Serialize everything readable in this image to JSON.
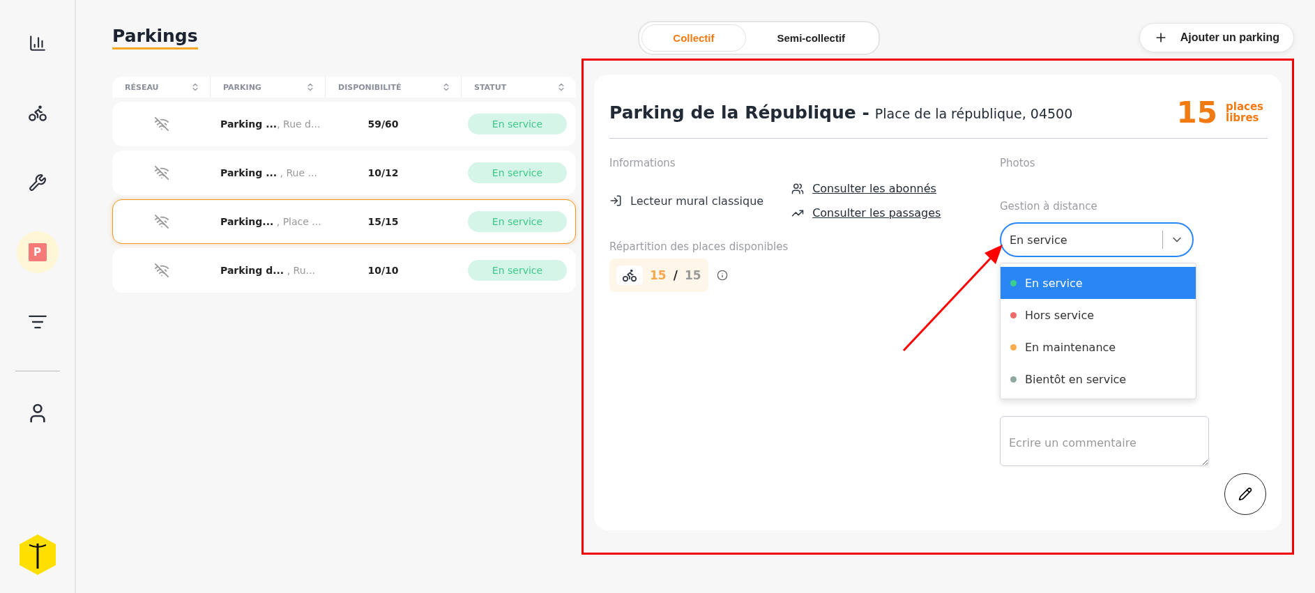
{
  "sidebar": {
    "items": [
      {
        "kind": "stats",
        "selected": false
      },
      {
        "kind": "bike",
        "selected": false
      },
      {
        "kind": "wrench",
        "selected": false
      },
      {
        "kind": "parking",
        "label": "P",
        "selected": true
      },
      {
        "kind": "settings",
        "selected": false
      },
      {
        "kind": "divider"
      },
      {
        "kind": "user",
        "selected": false
      }
    ]
  },
  "header": {
    "title": "Parkings",
    "tabs": [
      {
        "label": "Collectif",
        "selected": true
      },
      {
        "label": "Semi-collectif",
        "selected": false
      }
    ],
    "add_button": "Ajouter un parking"
  },
  "table": {
    "columns": [
      "RÉSEAU",
      "PARKING",
      "DISPONIBILITÉ",
      "STATUT"
    ],
    "rows": [
      {
        "name": "Parking ...",
        "address": ", Rue d...",
        "availability": "59/60",
        "status": "En service",
        "selected": false
      },
      {
        "name": "Parking ...",
        "address": " , Rue ...",
        "availability": "10/12",
        "status": "En service",
        "selected": false
      },
      {
        "name": "Parking...",
        "address": " , Place ...",
        "availability": "15/15",
        "status": "En service",
        "selected": true
      },
      {
        "name": "Parking d...",
        "address": "  , Ru...",
        "availability": "10/10",
        "status": "En service",
        "selected": false
      }
    ]
  },
  "detail": {
    "title": "Parking de la République -",
    "address": "Place de la république, 04500",
    "free_count": "15",
    "free_label": "places libres",
    "informations": {
      "label": "Informations",
      "reader": "Lecteur mural classique",
      "links": [
        {
          "kind": "users",
          "label": "Consulter les abonnés"
        },
        {
          "kind": "trend",
          "label": "Consulter les passages"
        }
      ]
    },
    "distribution": {
      "label": "Répartition des places disponibles",
      "available": "15",
      "separator": "/",
      "total": "15"
    },
    "photos": {
      "label": "Photos"
    },
    "remote": {
      "label": "Gestion à distance",
      "value": "En service",
      "open": true,
      "options": [
        {
          "label": "En service",
          "color": "#3ad08b",
          "selected": true
        },
        {
          "label": "Hors service",
          "color": "#f06a6a",
          "selected": false
        },
        {
          "label": "En maintenance",
          "color": "#ffa94d",
          "selected": false
        },
        {
          "label": "Bientôt en service",
          "color": "#8fa9a0",
          "selected": false
        }
      ]
    },
    "comment": {
      "placeholder": "Ecrire un commentaire"
    }
  }
}
